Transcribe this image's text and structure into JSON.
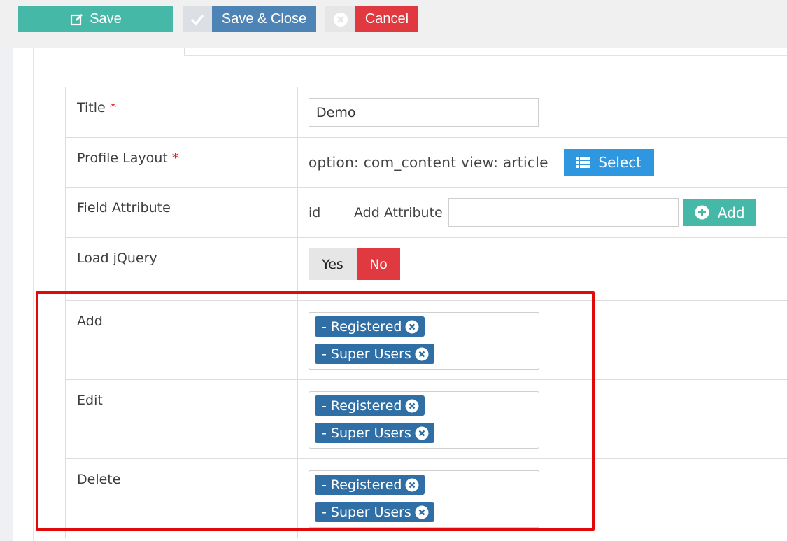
{
  "toolbar": {
    "save_label": "Save",
    "save_close_label": "Save & Close",
    "cancel_label": "Cancel"
  },
  "form": {
    "title_label": "Title",
    "title_value": "Demo",
    "required_mark": "*",
    "profile_layout_label": "Profile Layout",
    "profile_layout_value": "option: com_content view: article",
    "select_label": "Select",
    "field_attribute_label": "Field Attribute",
    "field_attribute_id": "id",
    "add_attribute_label": "Add Attribute",
    "add_attribute_value": "",
    "add_button_label": "Add",
    "load_jquery_label": "Load jQuery",
    "yes_label": "Yes",
    "no_label": "No",
    "load_jquery_selected": "No"
  },
  "permissions": {
    "add": {
      "label": "Add",
      "groups": [
        "- Registered",
        "- Super Users"
      ]
    },
    "edit": {
      "label": "Edit",
      "groups": [
        "- Registered",
        "- Super Users"
      ]
    },
    "delete": {
      "label": "Delete",
      "groups": [
        "- Registered",
        "- Super Users"
      ]
    }
  },
  "colors": {
    "save": "#46b8a8",
    "save_close": "#4e83b5",
    "cancel": "#e0393f",
    "select": "#2f97df",
    "chip": "#2f6fa5",
    "highlight": "#e10a0a"
  }
}
